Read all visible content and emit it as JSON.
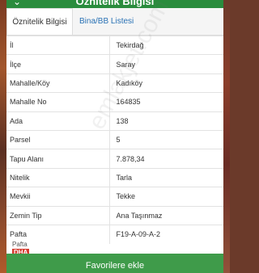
{
  "header": {
    "title": "Öznitelik Bilgisi",
    "chevron": "⌄"
  },
  "tabs": [
    {
      "label": "Öznitelik Bilgisi",
      "active": true
    },
    {
      "label": "Bina/BB Listesi",
      "active": false
    }
  ],
  "rows": [
    {
      "label": "İl",
      "value": "Tekirdağ"
    },
    {
      "label": "İlçe",
      "value": "Saray"
    },
    {
      "label": "Mahalle/Köy",
      "value": "Kadıköy"
    },
    {
      "label": "Mahalle No",
      "value": "164835"
    },
    {
      "label": "Ada",
      "value": "138"
    },
    {
      "label": "Parsel",
      "value": "5"
    },
    {
      "label": "Tapu Alanı",
      "value": "7.878,34"
    },
    {
      "label": "Nitelik",
      "value": "Tarla"
    },
    {
      "label": "Mevkii",
      "value": "Tekke"
    },
    {
      "label": "Zemin Tip",
      "value": "Ana Taşınmaz"
    },
    {
      "label": "Pafta",
      "value": "F19-A-09-A-2"
    }
  ],
  "watermark": "emlakjet.com",
  "badge": {
    "line1": "Pafta",
    "line2": "DHA"
  },
  "footer": {
    "favorite_label": "Favorilere ekle"
  },
  "colors": {
    "header_green": "#2a8c3d",
    "button_green": "#3f9b4a",
    "tab_link_blue": "#2a72b5"
  }
}
